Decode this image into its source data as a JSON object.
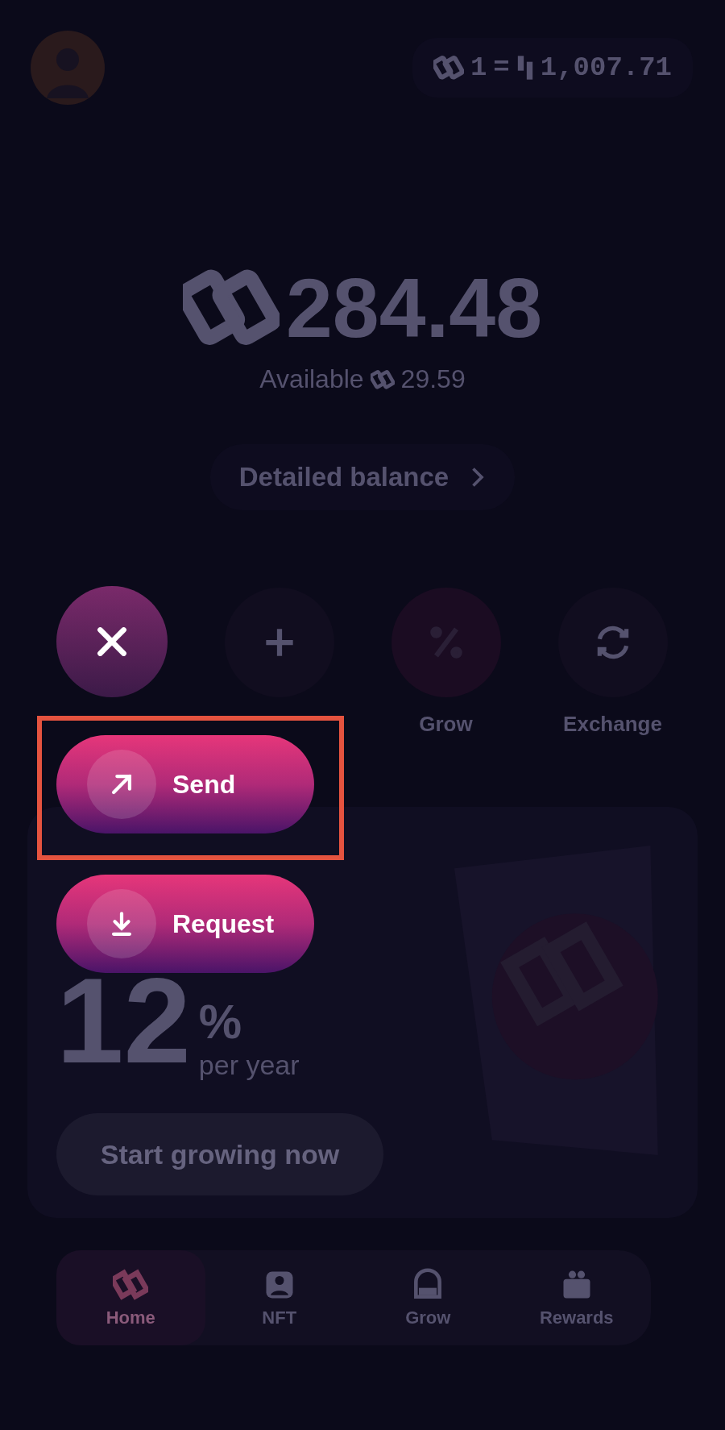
{
  "header": {
    "rate_amount": "1",
    "rate_equals": "=",
    "rate_value": "1,007.71"
  },
  "balance": {
    "amount": "284.48",
    "available_label": "Available",
    "available_amount": "29.59",
    "details_button": "Detailed balance"
  },
  "actions": [
    {
      "kind": "plus"
    },
    {
      "kind": "percent",
      "label": "Grow"
    },
    {
      "kind": "exchange",
      "label": "Exchange"
    }
  ],
  "promo": {
    "rate": "12",
    "unit": "%",
    "period": "per year",
    "button": "Start growing now"
  },
  "nav": [
    {
      "kind": "home",
      "label": "Home",
      "selected": true
    },
    {
      "kind": "nft",
      "label": "NFT",
      "selected": false
    },
    {
      "kind": "grow",
      "label": "Grow",
      "selected": false
    },
    {
      "kind": "rewards",
      "label": "Rewards",
      "selected": false
    }
  ],
  "menu": [
    {
      "kind": "send",
      "label": "Send",
      "highlighted": true
    },
    {
      "kind": "request",
      "label": "Request",
      "highlighted": false
    }
  ]
}
